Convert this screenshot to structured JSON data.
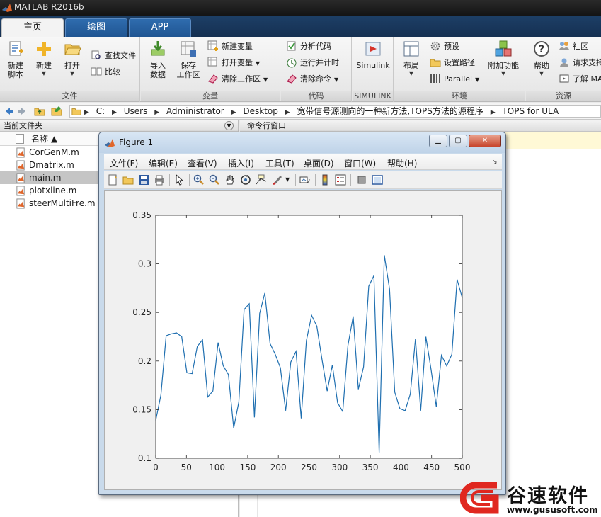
{
  "window": {
    "title": "MATLAB R2016b"
  },
  "tabs": [
    "主页",
    "绘图",
    "APP"
  ],
  "ribbon": {
    "file": {
      "label": "文件",
      "new_script": [
        "新建",
        "脚本"
      ],
      "new": "新建",
      "open": "打开",
      "find_files": "查找文件",
      "compare": "比较"
    },
    "variable": {
      "label": "变量",
      "import_data": [
        "导入",
        "数据"
      ],
      "save_workspace": [
        "保存",
        "工作区"
      ],
      "new_variable": "新建变量",
      "open_variable": "打开变量",
      "clear_workspace": "清除工作区"
    },
    "code": {
      "label": "代码",
      "analyze": "分析代码",
      "run_time": "运行并计时",
      "clear_commands": "清除命令"
    },
    "simulink": {
      "label": "SIMULINK",
      "button": "Simulink"
    },
    "environment": {
      "label": "环境",
      "layout": "布局",
      "preferences": "预设",
      "set_path": "设置路径",
      "parallel": "Parallel",
      "addons": "附加功能"
    },
    "resources": {
      "label": "资源",
      "help": "帮助",
      "community": "社区",
      "request_support": "请求支持",
      "learn": "了解 MA"
    }
  },
  "address": {
    "crumbs": [
      "C:",
      "Users",
      "Administrator",
      "Desktop",
      "宽带信号源测向的一种新方法,TOPS方法的源程序",
      "TOPS for ULA"
    ]
  },
  "current_folder": {
    "title": "当前文件夹",
    "column": "名称 ▲",
    "files": [
      "CorGenM.m",
      "Dmatrix.m",
      "main.m",
      "plotxline.m",
      "steerMultiFre.m"
    ],
    "selected_index": 2
  },
  "command_window": {
    "title": "命令行窗口"
  },
  "figure": {
    "title": "Figure 1",
    "menus": [
      "文件(F)",
      "编辑(E)",
      "查看(V)",
      "插入(I)",
      "工具(T)",
      "桌面(D)",
      "窗口(W)",
      "帮助(H)"
    ],
    "controls": {
      "minimize": "▁",
      "maximize": "▢",
      "close": "✕"
    }
  },
  "chart_data": {
    "type": "line",
    "x": [
      0,
      10,
      20,
      30,
      40,
      50,
      60,
      70,
      80,
      90,
      100,
      110,
      120,
      130,
      140,
      150,
      160,
      170,
      180,
      190,
      200,
      210,
      220,
      230,
      240,
      250,
      260,
      270,
      280,
      290,
      300,
      310,
      320,
      330,
      340,
      350,
      360,
      370,
      380,
      390,
      400,
      410,
      420,
      430,
      440,
      450,
      460,
      470,
      480,
      490,
      500
    ],
    "series": [
      {
        "values": [
          0.139,
          0.165,
          0.226,
          0.228,
          0.229,
          0.225,
          0.188,
          0.187,
          0.215,
          0.222,
          0.163,
          0.169,
          0.219,
          0.195,
          0.186,
          0.131,
          0.158,
          0.253,
          0.259,
          0.142,
          0.249,
          0.27,
          0.218,
          0.207,
          0.193,
          0.149,
          0.199,
          0.21,
          0.141,
          0.221,
          0.247,
          0.236,
          0.202,
          0.169,
          0.196,
          0.157,
          0.148,
          0.216,
          0.246,
          0.171,
          0.194,
          0.277,
          0.288,
          0.106,
          0.309,
          0.274,
          0.168,
          0.151,
          0.149,
          0.166,
          0.223,
          0.149,
          0.225,
          0.191,
          0.153,
          0.206,
          0.195,
          0.207,
          0.284,
          0.265
        ],
        "color": "#1f6fb0"
      }
    ],
    "xlim": [
      0,
      500
    ],
    "ylim": [
      0.1,
      0.35
    ],
    "xticks": [
      0,
      50,
      100,
      150,
      200,
      250,
      300,
      350,
      400,
      450,
      500
    ],
    "yticks": [
      0.1,
      0.15,
      0.2,
      0.25,
      0.3,
      0.35
    ],
    "ytick_labels": [
      "0.1",
      "0.15",
      "0.2",
      "0.25",
      "0.3",
      "0.35"
    ],
    "grid": false,
    "title": "",
    "xlabel": "",
    "ylabel": ""
  },
  "watermark": {
    "text": "谷速软件",
    "url": "www.gususoft.com"
  },
  "colors": {
    "accent": "#1f5592",
    "line": "#1f6fb0",
    "watermark_red": "#e0271f"
  }
}
